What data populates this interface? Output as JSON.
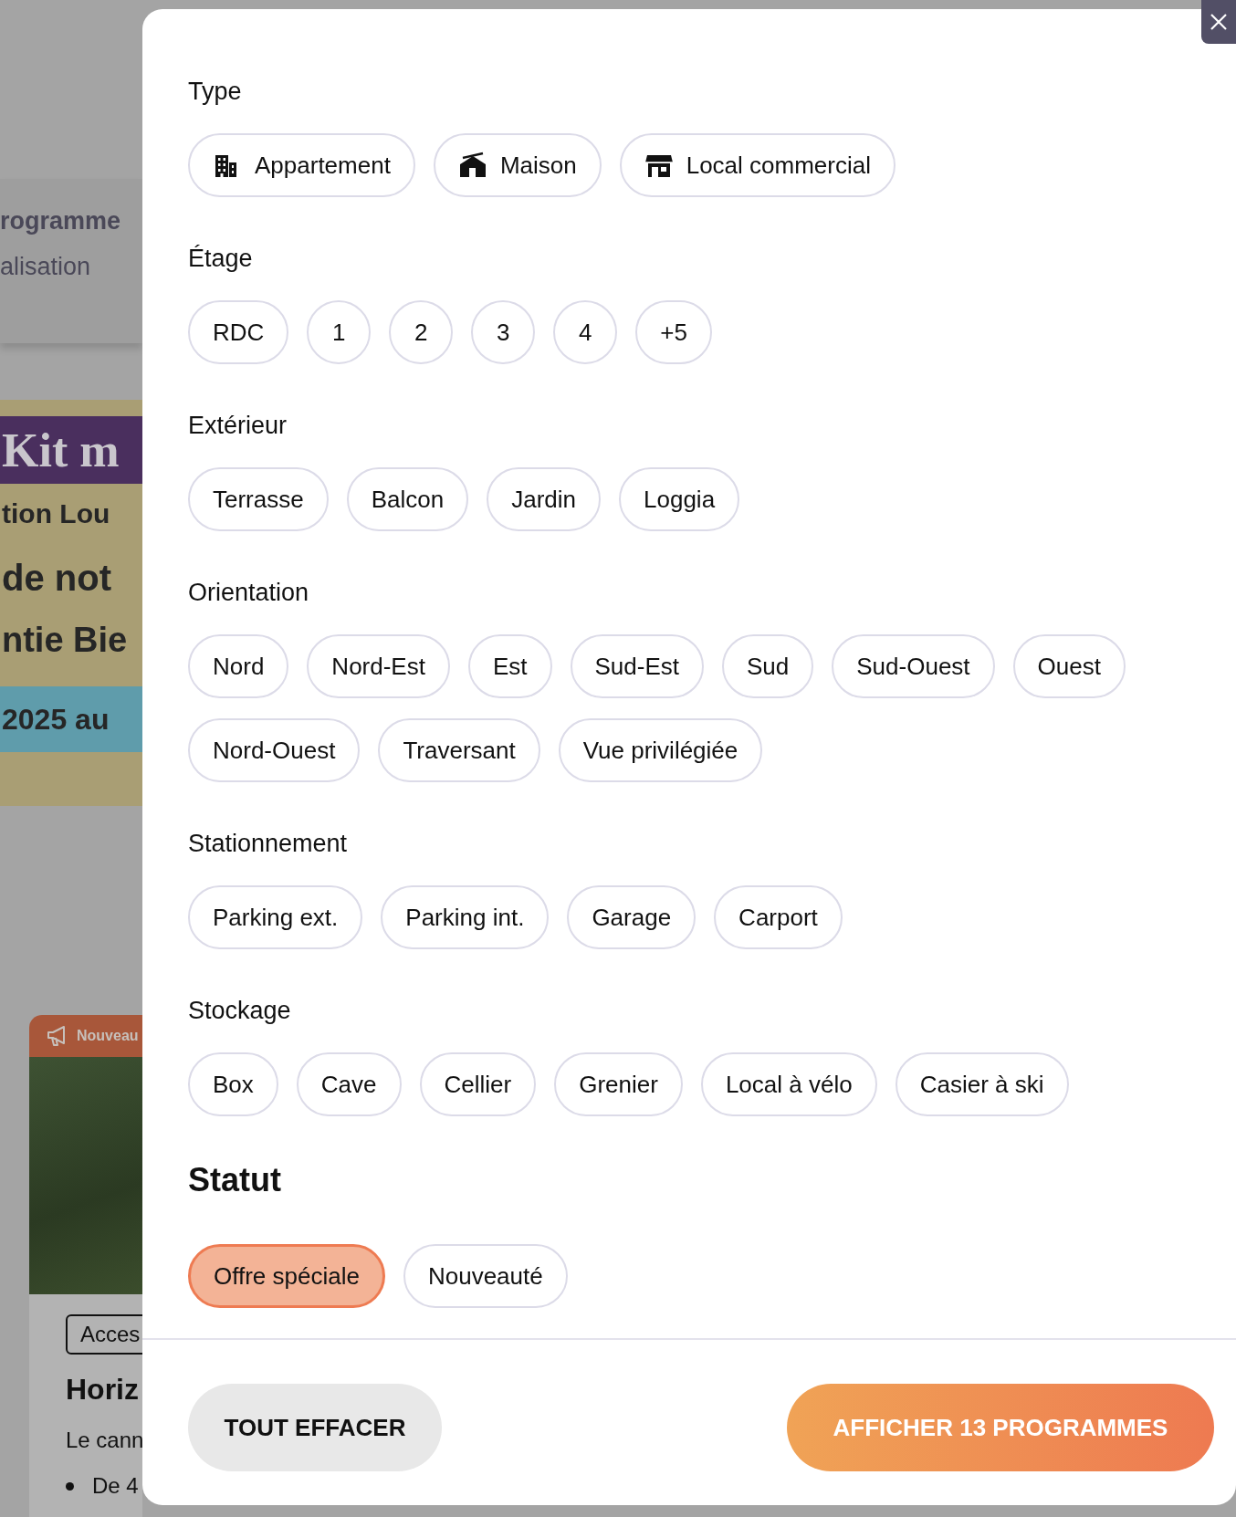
{
  "background_page": {
    "header_lines": [
      {
        "text": "rogramme",
        "bold": true
      },
      {
        "text": "alisation",
        "bold": false
      }
    ],
    "banner": {
      "title": "Kit m",
      "lines": [
        "tion Lou",
        "de not",
        "ntie Bie"
      ],
      "date": "2025 au"
    },
    "card": {
      "badge": "Nouveau",
      "tag": "Acces",
      "title": "Horiz",
      "description": "Le cann",
      "bullets": [
        "De 4"
      ]
    }
  },
  "filters": {
    "sections": [
      {
        "title": "Type",
        "options": [
          {
            "label": "Appartement",
            "selected": false
          },
          {
            "label": "Maison",
            "selected": false
          },
          {
            "label": "Local commercial",
            "selected": false
          }
        ]
      },
      {
        "title": "Étage",
        "options": [
          {
            "label": "RDC",
            "selected": false
          },
          {
            "label": "1",
            "selected": false
          },
          {
            "label": "2",
            "selected": false
          },
          {
            "label": "3",
            "selected": false
          },
          {
            "label": "4",
            "selected": false
          },
          {
            "label": "+5",
            "selected": false
          }
        ]
      },
      {
        "title": "Extérieur",
        "options": [
          {
            "label": "Terrasse",
            "selected": false
          },
          {
            "label": "Balcon",
            "selected": false
          },
          {
            "label": "Jardin",
            "selected": false
          },
          {
            "label": "Loggia",
            "selected": false
          }
        ]
      },
      {
        "title": "Orientation",
        "options": [
          {
            "label": "Nord",
            "selected": false
          },
          {
            "label": "Nord-Est",
            "selected": false
          },
          {
            "label": "Est",
            "selected": false
          },
          {
            "label": "Sud-Est",
            "selected": false
          },
          {
            "label": "Sud",
            "selected": false
          },
          {
            "label": "Sud-Ouest",
            "selected": false
          },
          {
            "label": "Ouest",
            "selected": false
          },
          {
            "label": "Nord-Ouest",
            "selected": false
          },
          {
            "label": "Traversant",
            "selected": false
          },
          {
            "label": "Vue privilégiée",
            "selected": false
          }
        ]
      },
      {
        "title": "Stationnement",
        "options": [
          {
            "label": "Parking ext.",
            "selected": false
          },
          {
            "label": "Parking int.",
            "selected": false
          },
          {
            "label": "Garage",
            "selected": false
          },
          {
            "label": "Carport",
            "selected": false
          }
        ]
      },
      {
        "title": "Stockage",
        "options": [
          {
            "label": "Box",
            "selected": false
          },
          {
            "label": "Cave",
            "selected": false
          },
          {
            "label": "Cellier",
            "selected": false
          },
          {
            "label": "Grenier",
            "selected": false
          },
          {
            "label": "Local à vélo",
            "selected": false
          },
          {
            "label": "Casier à ski",
            "selected": false
          }
        ]
      }
    ],
    "status_section": {
      "title": "Statut",
      "options": [
        {
          "label": "Offre spéciale",
          "selected": true
        },
        {
          "label": "Nouveauté",
          "selected": false
        }
      ]
    }
  },
  "footer": {
    "clear_button": "TOUT EFFACER",
    "apply_button": "AFFICHER 13 PROGRAMMES"
  }
}
